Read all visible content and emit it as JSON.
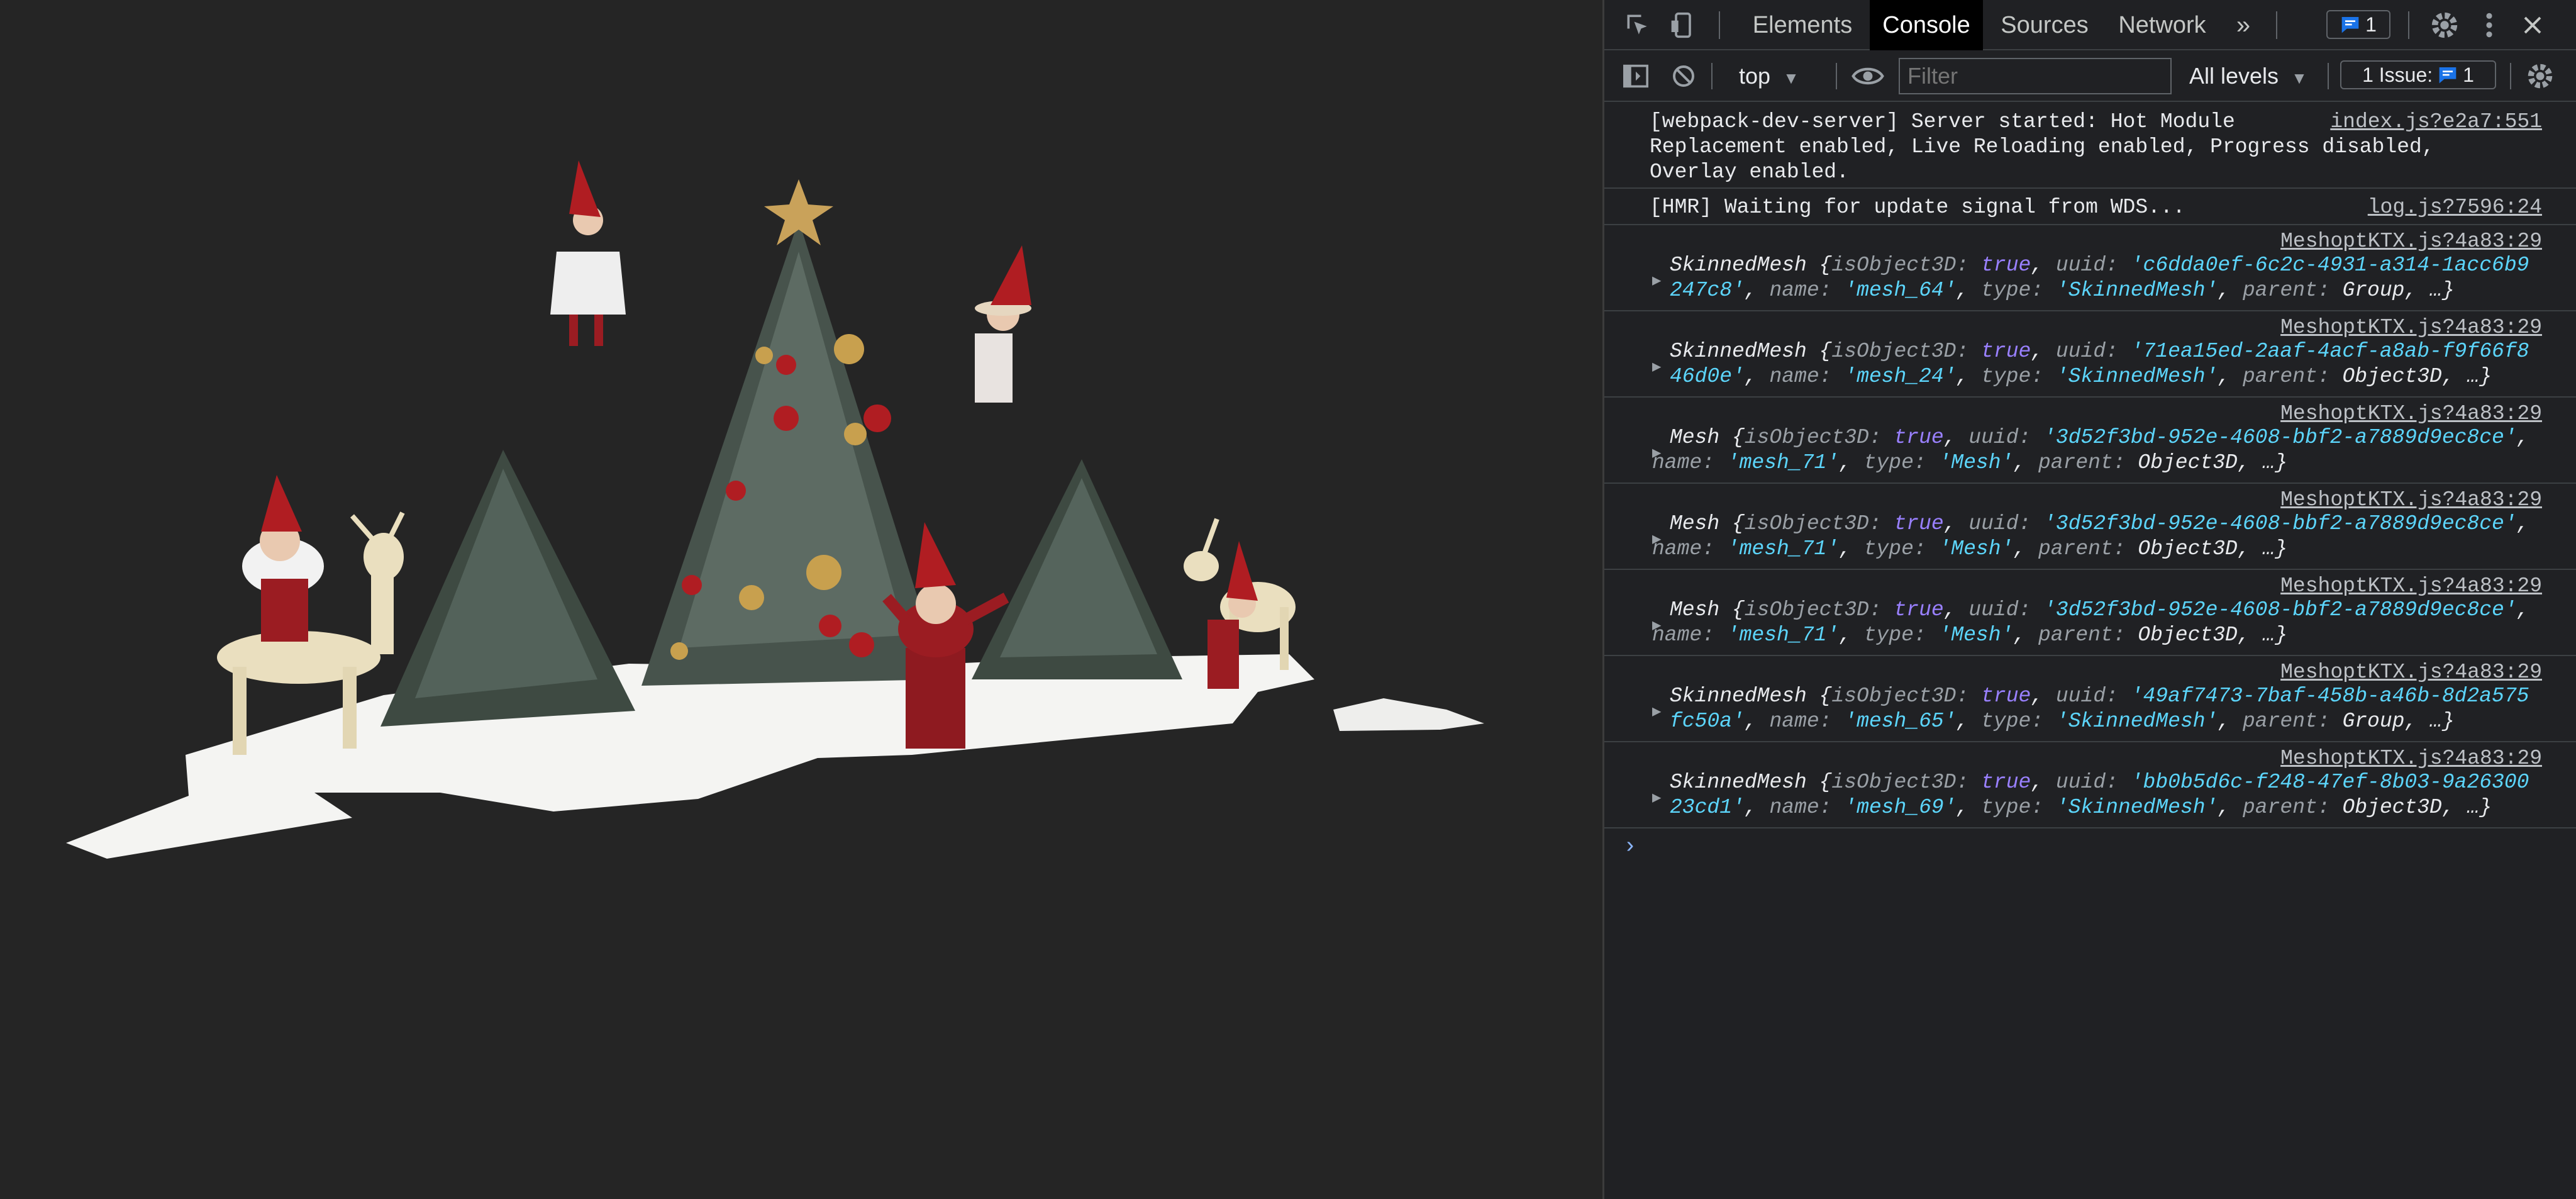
{
  "devtools": {
    "tabs": [
      "Elements",
      "Console",
      "Sources",
      "Network"
    ],
    "active_tab": "Console",
    "more_tabs": "»",
    "message_badge_count": "1",
    "toolbar": {
      "context": "top",
      "filter_placeholder": "Filter",
      "levels": "All levels",
      "issues_label": "1 Issue:",
      "issues_count": "1"
    }
  },
  "console": {
    "messages": [
      {
        "source": "index.js?e2a7:551",
        "lines": [
          "[webpack-dev-server] Server started: Hot Module",
          "Replacement enabled, Live Reloading enabled, Progress disabled,",
          "Overlay enabled."
        ]
      },
      {
        "source": "log.js?7596:24",
        "lines": [
          "[HMR] Waiting for update signal from WDS..."
        ]
      },
      {
        "source": "MeshoptKTX.js?4a83:29",
        "class": "SkinnedMesh",
        "uuid_part1": "'c6dda0ef-6c2c-4931-a314-1acc6b9",
        "uuid_part2": "247c8'",
        "name": "'mesh_64'",
        "type": "'SkinnedMesh'",
        "parent": "Group"
      },
      {
        "source": "MeshoptKTX.js?4a83:29",
        "class": "SkinnedMesh",
        "uuid_part1": "'71ea15ed-2aaf-4acf-a8ab-f9f66f8",
        "uuid_part2": "46d0e'",
        "name": "'mesh_24'",
        "type": "'SkinnedMesh'",
        "parent": "Object3D"
      },
      {
        "source": "MeshoptKTX.js?4a83:29",
        "class": "Mesh",
        "uuid_part1": "'3d52f3bd-952e-4608-bbf2-a7889d9ec8ce'",
        "name": "'mesh_71'",
        "type": "'Mesh'",
        "parent": "Object3D"
      },
      {
        "source": "MeshoptKTX.js?4a83:29",
        "class": "Mesh",
        "uuid_part1": "'3d52f3bd-952e-4608-bbf2-a7889d9ec8ce'",
        "name": "'mesh_71'",
        "type": "'Mesh'",
        "parent": "Object3D"
      },
      {
        "source": "MeshoptKTX.js?4a83:29",
        "class": "Mesh",
        "uuid_part1": "'3d52f3bd-952e-4608-bbf2-a7889d9ec8ce'",
        "name": "'mesh_71'",
        "type": "'Mesh'",
        "parent": "Object3D"
      },
      {
        "source": "MeshoptKTX.js?4a83:29",
        "class": "SkinnedMesh",
        "uuid_part1": "'49af7473-7baf-458b-a46b-8d2a575",
        "uuid_part2": "fc50a'",
        "name": "'mesh_65'",
        "type": "'SkinnedMesh'",
        "parent": "Group"
      },
      {
        "source": "MeshoptKTX.js?4a83:29",
        "class": "SkinnedMesh",
        "uuid_part1": "'bb0b5d6c-f248-47ef-8b03-9a26300",
        "uuid_part2": "23cd1'",
        "name": "'mesh_69'",
        "type": "'SkinnedMesh'",
        "parent": "Object3D"
      }
    ],
    "prompt": "›"
  },
  "scene": {
    "background_color": "#252525",
    "snow_color": "#f4f4f2",
    "tree_color": "#3e4a42",
    "elf_color": "#9b1c22"
  }
}
